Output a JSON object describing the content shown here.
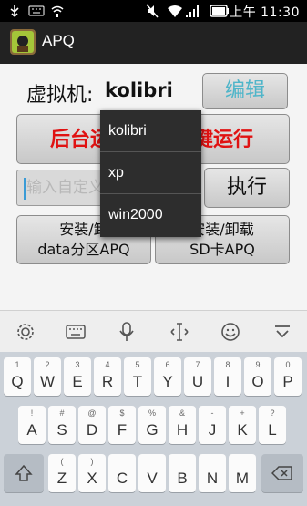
{
  "status_bar": {
    "time": "上午 11:30"
  },
  "app": {
    "title": "APQ"
  },
  "vm": {
    "label": "虚拟机:",
    "name": "kolibri"
  },
  "buttons": {
    "edit": "编辑",
    "background_run": "后台运",
    "one_key_run": "键运行",
    "execute": "执行",
    "data_install_line1": "安装/卸",
    "data_install_line2": "data分区APQ",
    "sd_install_line1": "安装/卸载",
    "sd_install_line2": "SD卡APQ"
  },
  "command_input": {
    "placeholder": "输入自定义"
  },
  "dropdown": {
    "items": [
      "kolibri",
      "xp",
      "win2000"
    ]
  },
  "keyboard": {
    "row1": [
      {
        "k": "Q",
        "n": "1"
      },
      {
        "k": "W",
        "n": "2"
      },
      {
        "k": "E",
        "n": "3"
      },
      {
        "k": "R",
        "n": "4"
      },
      {
        "k": "T",
        "n": "5"
      },
      {
        "k": "Y",
        "n": "6"
      },
      {
        "k": "U",
        "n": "7"
      },
      {
        "k": "I",
        "n": "8"
      },
      {
        "k": "O",
        "n": "9"
      },
      {
        "k": "P",
        "n": "0"
      }
    ],
    "row2": [
      {
        "k": "A",
        "n": "!"
      },
      {
        "k": "S",
        "n": "#"
      },
      {
        "k": "D",
        "n": "@"
      },
      {
        "k": "F",
        "n": "$"
      },
      {
        "k": "G",
        "n": "%"
      },
      {
        "k": "H",
        "n": "&"
      },
      {
        "k": "J",
        "n": "-"
      },
      {
        "k": "K",
        "n": "+"
      },
      {
        "k": "L",
        "n": "?"
      }
    ],
    "row3": [
      {
        "k": "Z",
        "n": "("
      },
      {
        "k": "X",
        "n": ")"
      },
      {
        "k": "C",
        "n": ""
      },
      {
        "k": "V",
        "n": ""
      },
      {
        "k": "B",
        "n": ""
      },
      {
        "k": "N",
        "n": ""
      },
      {
        "k": "M",
        "n": ""
      }
    ]
  },
  "colors": {
    "accent_edit": "#4fb5c9",
    "run_red": "#e01212",
    "dropdown_bg": "#2d2d2d"
  }
}
